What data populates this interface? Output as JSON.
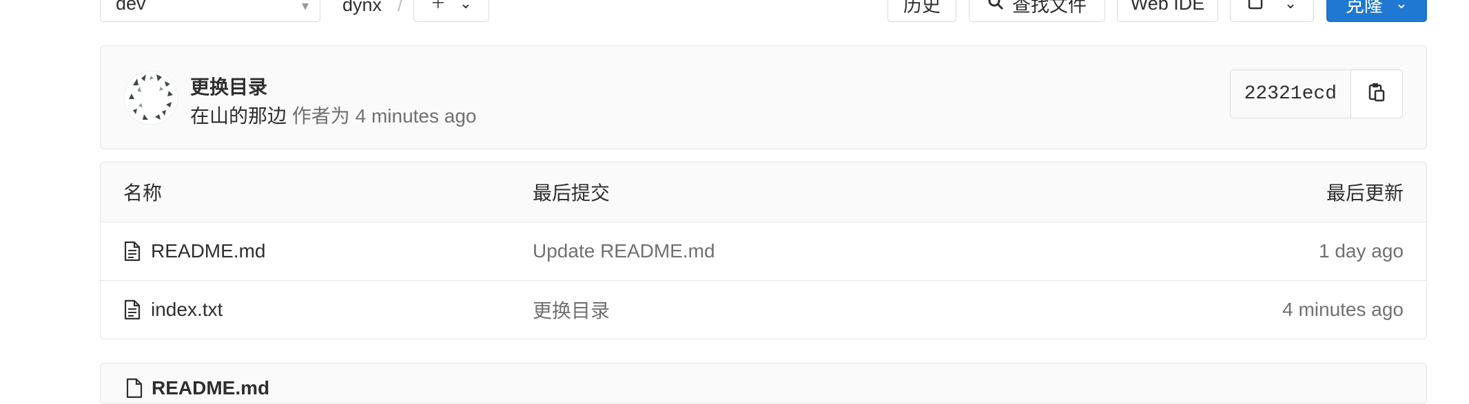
{
  "toolbar": {
    "branch": "dev",
    "project_crumb": "dynx",
    "crumb_separator": "/",
    "add_icon": "plus-icon",
    "history_label": "历史",
    "find_file_label": "查找文件",
    "web_ide_label": "Web IDE",
    "clone_label": "克隆"
  },
  "commit": {
    "title": "更换目录",
    "author": "在山的那边",
    "authored_prefix": "作者为",
    "time": "4 minutes ago",
    "sha": "22321ecd",
    "copy_icon": "clipboard-icon"
  },
  "tree": {
    "columns": {
      "name": "名称",
      "last_commit": "最后提交",
      "last_update": "最后更新"
    },
    "rows": [
      {
        "name": "README.md",
        "commit": "Update README.md",
        "updated": "1 day ago"
      },
      {
        "name": "index.txt",
        "commit": "更换目录",
        "updated": "4 minutes ago"
      }
    ]
  },
  "readme": {
    "title": "README.md"
  },
  "colors": {
    "primary": "#1f78d1",
    "border": "#e5e5e5",
    "panel_bg": "#fafafa",
    "muted_text": "#707070"
  }
}
